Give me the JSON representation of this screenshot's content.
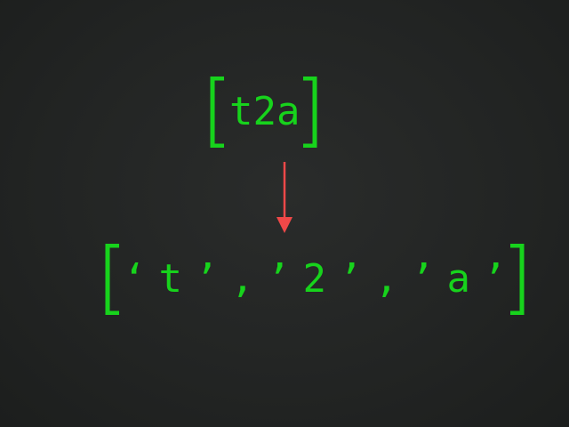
{
  "source_text": "t2a",
  "result_items": [
    "t",
    "2",
    "a"
  ],
  "colors": {
    "background": "#222423",
    "text": "#17d31c",
    "arrow": "#f04848"
  },
  "icons": {
    "bracket_open": "left-square-bracket",
    "bracket_close": "right-square-bracket",
    "arrow": "arrow-down"
  }
}
